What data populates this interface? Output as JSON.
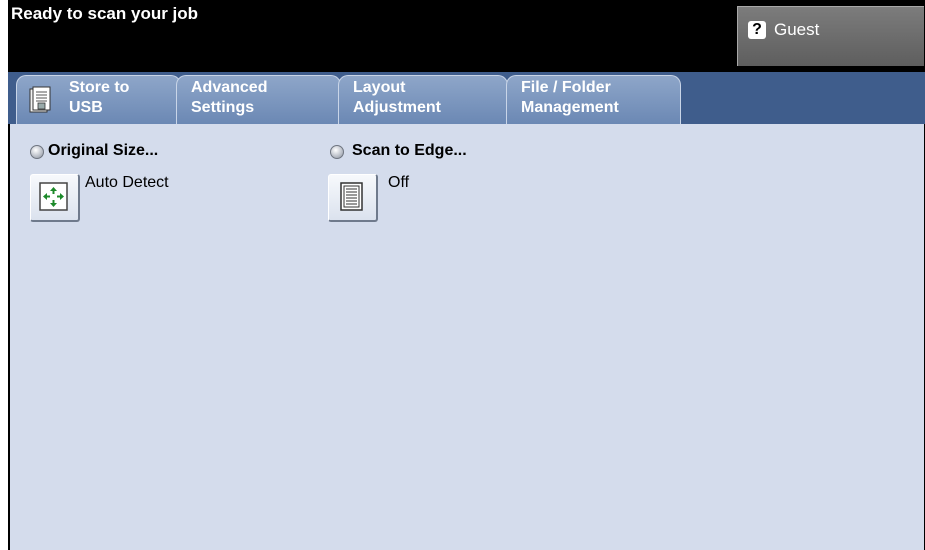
{
  "status": {
    "text": "Ready to scan your job"
  },
  "guest_button": {
    "icon": "help-icon",
    "label": "Guest"
  },
  "tabs": [
    {
      "label": "Store to\nUSB",
      "icon": "usb-store-icon",
      "active": false
    },
    {
      "label": "Advanced\nSettings",
      "active": false
    },
    {
      "label": "Layout\nAdjustment",
      "active": true
    },
    {
      "label": "File / Folder\nManagement",
      "active": false
    }
  ],
  "options": {
    "original_size": {
      "label": "Original Size...",
      "value": "Auto Detect",
      "icon": "auto-detect-icon"
    },
    "scan_to_edge": {
      "label": "Scan to Edge...",
      "value": "Off",
      "icon": "scan-to-edge-icon"
    }
  },
  "colors": {
    "tab_strip": "#3f5d8c",
    "content_bg": "#d4dcec",
    "header_bg": "#000000"
  }
}
